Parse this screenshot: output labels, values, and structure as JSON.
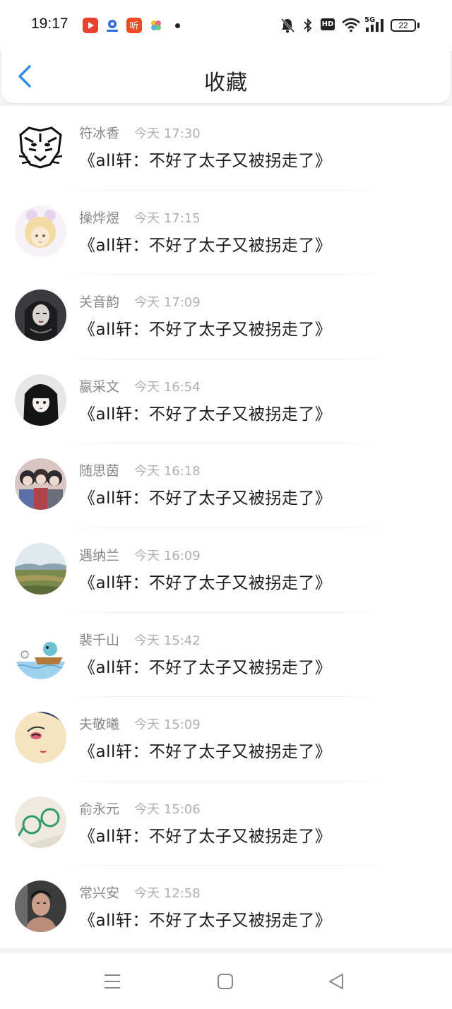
{
  "status_bar": {
    "time": "19:17",
    "app_icons": [
      "video-app-icon",
      "map-app-icon",
      "listen-app-icon",
      "photos-app-icon"
    ],
    "system_icons": [
      "mute-icon",
      "bluetooth-icon",
      "hd-icon",
      "wifi-icon",
      "signal-5g-icon"
    ],
    "hd_label": "HD",
    "network_label": "5G",
    "battery_level": "22"
  },
  "header": {
    "title": "收藏"
  },
  "favorites": [
    {
      "user": "符冰香",
      "time": "今天 17:30",
      "title": "《all轩：不好了太子又被拐走了》"
    },
    {
      "user": "操烨煜",
      "time": "今天 17:15",
      "title": "《all轩：不好了太子又被拐走了》"
    },
    {
      "user": "关音韵",
      "time": "今天 17:09",
      "title": "《all轩：不好了太子又被拐走了》"
    },
    {
      "user": "嬴采文",
      "time": "今天 16:54",
      "title": "《all轩：不好了太子又被拐走了》"
    },
    {
      "user": "随思茵",
      "time": "今天 16:18",
      "title": "《all轩：不好了太子又被拐走了》"
    },
    {
      "user": "遇纳兰",
      "time": "今天 16:09",
      "title": "《all轩：不好了太子又被拐走了》"
    },
    {
      "user": "裴千山",
      "time": "今天 15:42",
      "title": "《all轩：不好了太子又被拐走了》"
    },
    {
      "user": "夫敬曦",
      "time": "今天 15:09",
      "title": "《all轩：不好了太子又被拐走了》"
    },
    {
      "user": "俞永元",
      "time": "今天 15:06",
      "title": "《all轩：不好了太子又被拐走了》"
    },
    {
      "user": "常兴安",
      "time": "今天 12:58",
      "title": "《all轩：不好了太子又被拐走了》"
    }
  ],
  "nav_bar": {
    "buttons": [
      "menu-icon",
      "home-icon",
      "back-triangle-icon"
    ]
  },
  "colors": {
    "accent": "#2d8cf0",
    "name_text": "#888888",
    "time_text": "#b0b0b0",
    "title_text": "#1a1a1a"
  }
}
